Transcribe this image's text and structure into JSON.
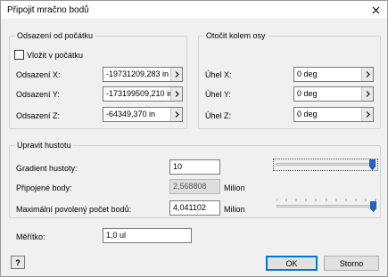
{
  "dialog": {
    "title": "Připojit mračno bodů"
  },
  "offset": {
    "group_title": "Odsazení od počátku",
    "insert_at_origin_label": "Vložit v počátku",
    "x": {
      "label": "Odsazení X:",
      "value": "-19731209,283 in"
    },
    "y": {
      "label": "Odsazení Y:",
      "value": "-173199509,210 in"
    },
    "z": {
      "label": "Odsazení Z:",
      "value": "-64349,370 in"
    }
  },
  "rotation": {
    "group_title": "Otočit kolem osy",
    "x": {
      "label": "Úhel X:",
      "value": "0 deg"
    },
    "y": {
      "label": "Úhel Y:",
      "value": "0 deg"
    },
    "z": {
      "label": "Úhel Z:",
      "value": "0 deg"
    }
  },
  "density": {
    "group_title": "Upravit hustotu",
    "gradient": {
      "label": "Gradient hustoty:",
      "value": "10",
      "slider_fraction": 1.0
    },
    "attached": {
      "label": "Připojené body:",
      "value": "2,568808",
      "unit": "Milion"
    },
    "max_points": {
      "label": "Maximální povolený počet bodů:",
      "value": "4,041102",
      "unit": "Milion",
      "slider_fraction": 1.0
    }
  },
  "scale": {
    "label": "Měřítko:",
    "value": "1,0 ul"
  },
  "buttons": {
    "help_glyph": "?",
    "ok": "OK",
    "cancel": "Storno"
  },
  "icons": {
    "close": "close-icon",
    "arrow": "arrow-right-icon",
    "help": "help-icon"
  },
  "colors": {
    "accent": "#0078d7",
    "slider_thumb": "#1e66c9"
  }
}
